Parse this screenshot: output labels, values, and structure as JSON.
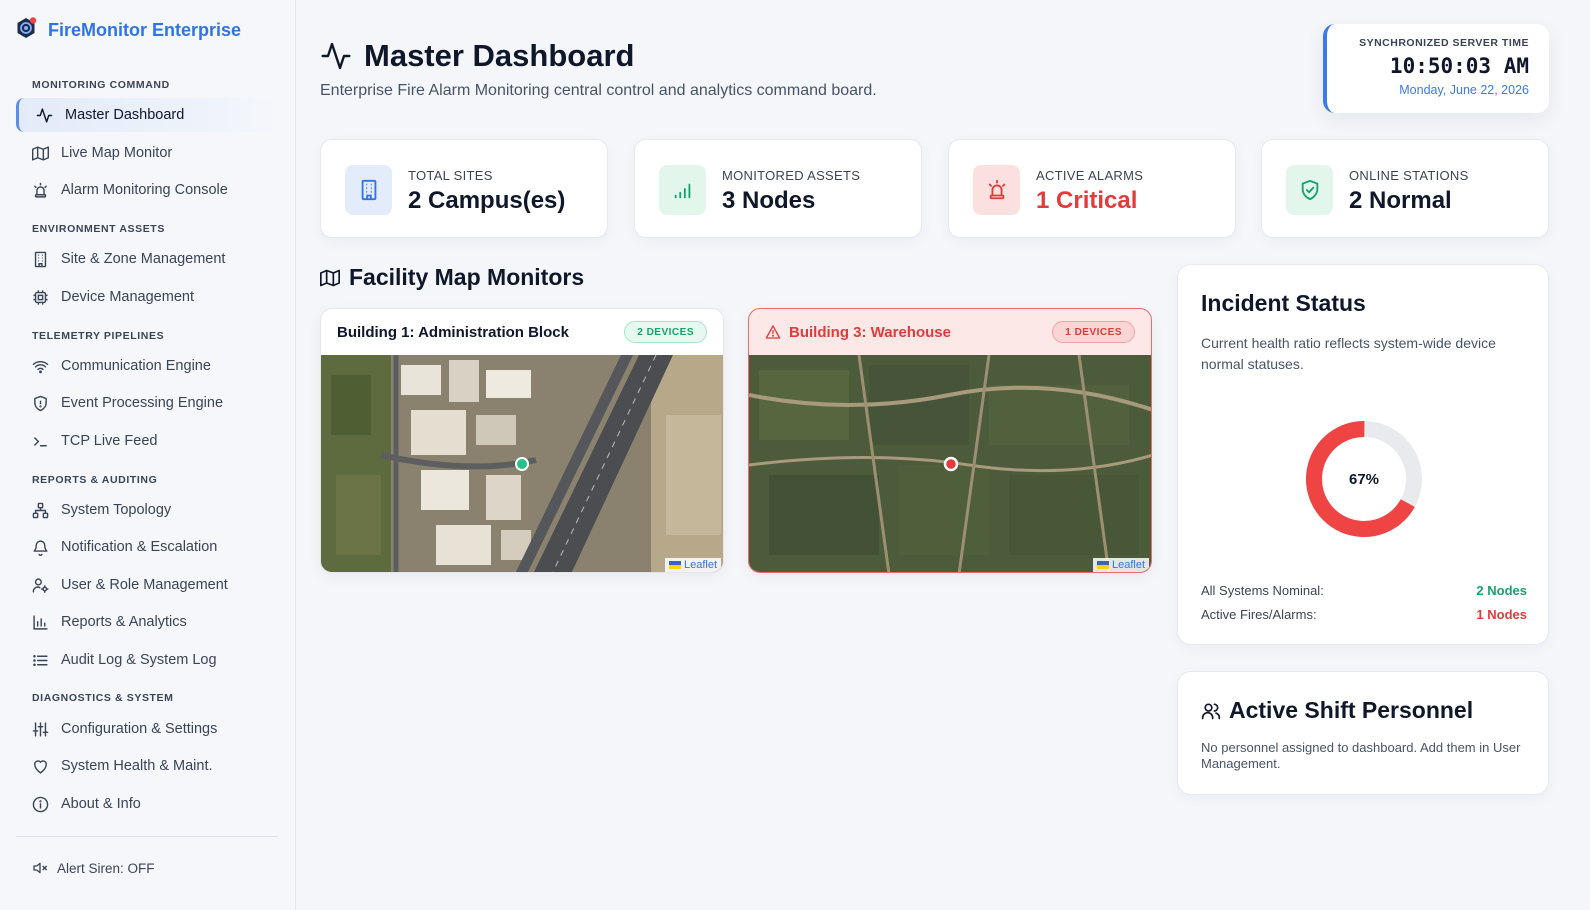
{
  "app": {
    "name": "FireMonitor Enterprise"
  },
  "sidebar": {
    "sections": [
      {
        "title": "MONITORING COMMAND"
      },
      {
        "title": "ENVIRONMENT ASSETS"
      },
      {
        "title": "TELEMETRY PIPELINES"
      },
      {
        "title": "REPORTS & AUDITING"
      },
      {
        "title": "DIAGNOSTICS & SYSTEM"
      }
    ],
    "items": [
      {
        "label": "Master Dashboard",
        "icon": "activity-icon",
        "active": true
      },
      {
        "label": "Live Map Monitor",
        "icon": "map-icon"
      },
      {
        "label": "Alarm Monitoring Console",
        "icon": "siren-icon"
      },
      {
        "label": "Site & Zone Management",
        "icon": "building-icon"
      },
      {
        "label": "Device Management",
        "icon": "chip-icon"
      },
      {
        "label": "Communication Engine",
        "icon": "wifi-icon"
      },
      {
        "label": "Event Processing Engine",
        "icon": "shield-icon"
      },
      {
        "label": "TCP Live Feed",
        "icon": "terminal-icon"
      },
      {
        "label": "System Topology",
        "icon": "topology-icon"
      },
      {
        "label": "Notification & Escalation",
        "icon": "bell-icon"
      },
      {
        "label": "User & Role Management",
        "icon": "user-cog-icon"
      },
      {
        "label": "Reports & Analytics",
        "icon": "bar-chart-icon"
      },
      {
        "label": "Audit Log & System Log",
        "icon": "list-icon"
      },
      {
        "label": "Configuration & Settings",
        "icon": "sliders-icon"
      },
      {
        "label": "System Health & Maint.",
        "icon": "heart-icon"
      },
      {
        "label": "About & Info",
        "icon": "info-icon"
      }
    ],
    "siren": {
      "label": "Alert Siren: OFF",
      "icon": "speaker-mute-icon"
    }
  },
  "header": {
    "title": "Master Dashboard",
    "subtitle": "Enterprise Fire Alarm Monitoring central control and analytics command board."
  },
  "clock": {
    "label": "SYNCHRONIZED SERVER TIME",
    "time": "10:50:03 AM",
    "date": "Monday, June 22, 2026"
  },
  "stats": [
    {
      "label": "TOTAL SITES",
      "value": "2 Campus(es)",
      "icon": "building-icon",
      "color": "#2f74e6",
      "bg": "#e3ecfb"
    },
    {
      "label": "MONITORED ASSETS",
      "value": "3 Nodes",
      "icon": "signal-icon",
      "color": "#16a36a",
      "bg": "#e2f6ec"
    },
    {
      "label": "ACTIVE ALARMS",
      "value": "1 Critical",
      "icon": "siren-icon",
      "color": "#e13b3b",
      "bg": "#fbe0e0"
    },
    {
      "label": "ONLINE STATIONS",
      "value": "2 Normal",
      "icon": "shield-check-icon",
      "color": "#16a36a",
      "bg": "#e2f6ec"
    }
  ],
  "facility": {
    "title": "Facility Map Monitors",
    "maps": [
      {
        "name": "Building 1: Administration Block",
        "badge": "2 DEVICES",
        "status": "normal",
        "attribution": "Leaflet"
      },
      {
        "name": "Building 3: Warehouse",
        "badge": "1 DEVICES",
        "status": "alarm",
        "attribution": "Leaflet"
      }
    ]
  },
  "incident": {
    "title": "Incident Status",
    "description": "Current health ratio reflects system-wide device normal statuses.",
    "percent_label": "67%",
    "health_ratio": 0.67,
    "rows": [
      {
        "label": "All Systems Nominal:",
        "value": "2 Nodes"
      },
      {
        "label": "Active Fires/Alarms:",
        "value": "1 Nodes"
      }
    ],
    "colors": {
      "ring": "#ee4444",
      "track": "#e8eaee"
    }
  },
  "personnel": {
    "title": "Active Shift Personnel",
    "message": "No personnel assigned to dashboard. Add them in User Management."
  }
}
